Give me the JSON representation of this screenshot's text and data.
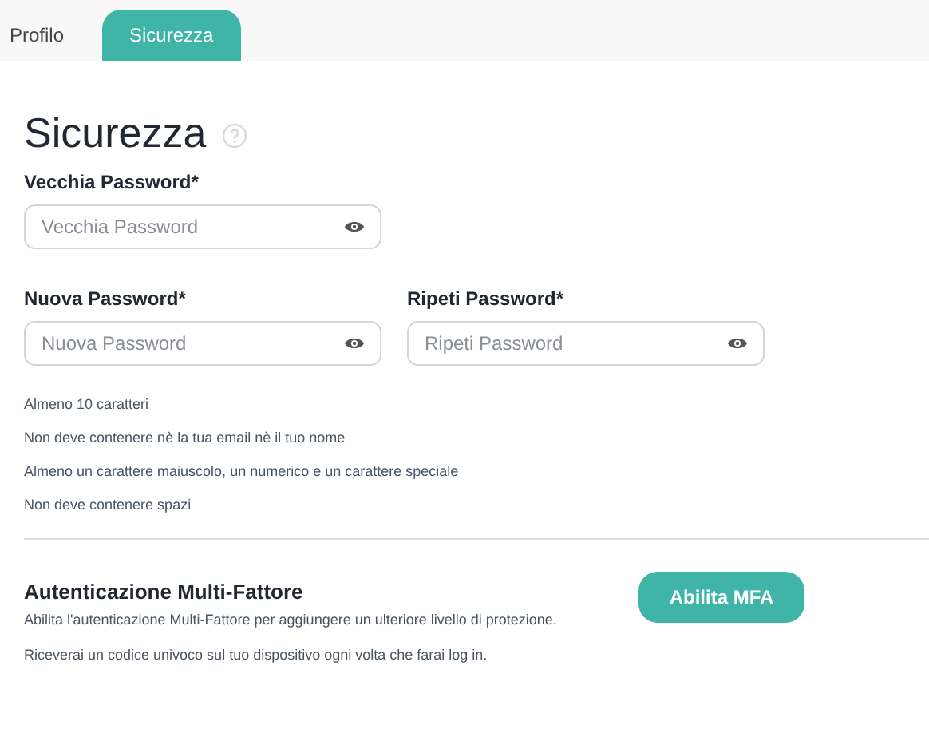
{
  "tabs": [
    {
      "label": "Profilo",
      "selected": false
    },
    {
      "label": "Sicurezza",
      "selected": true
    }
  ],
  "title": "Sicurezza",
  "fields": [
    {
      "label": "Vecchia Password*",
      "placeholder": "Vecchia Password"
    },
    {
      "label": "Nuova Password*",
      "placeholder": "Nuova Password"
    },
    {
      "label": "Ripeti Password*",
      "placeholder": "Ripeti Password"
    }
  ],
  "rules": [
    "Almeno 10 caratteri",
    "Non deve contenere nè la tua email nè il tuo nome",
    "Almeno un carattere maiuscolo, un numerico e un carattere speciale",
    "Non deve contenere spazi"
  ],
  "mfa": {
    "title": "Autenticazione Multi-Fattore",
    "lines": [
      "Abilita l'autenticazione Multi-Fattore per aggiungere un ulteriore livello di protezione.",
      "Riceverai un codice univoco sul tuo dispositivo ogni volta che farai log in."
    ],
    "button": "Abilita MFA"
  }
}
